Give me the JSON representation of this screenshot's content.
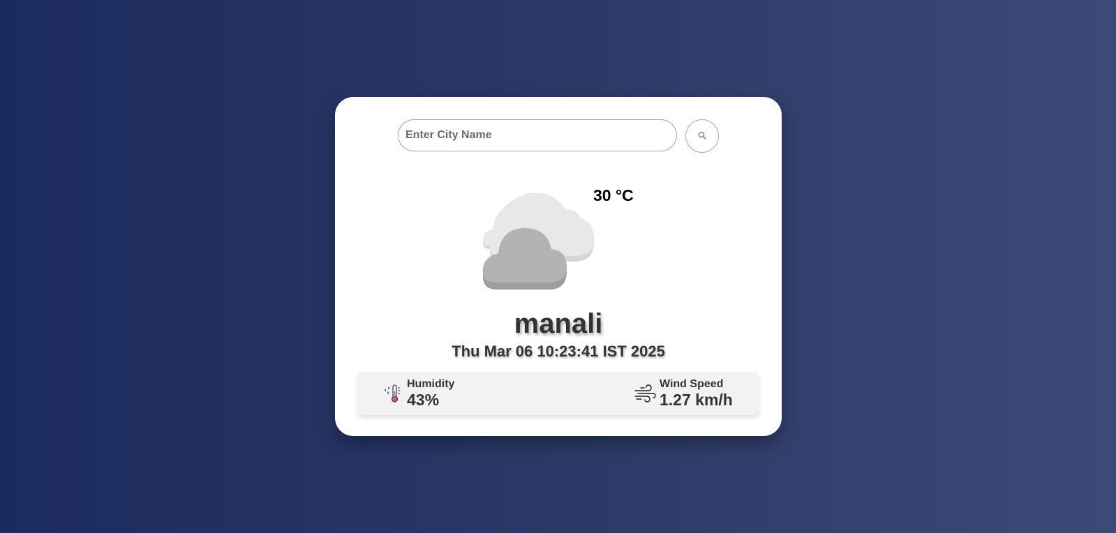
{
  "search": {
    "placeholder": "Enter City Name",
    "value": "",
    "button_icon": "search-icon"
  },
  "weather": {
    "icon": "cloudy-icon",
    "temperature": "30 °C",
    "city": "manali",
    "datetime": "Thu Mar 06 10:23:41 IST 2025"
  },
  "details": {
    "humidity": {
      "icon": "humidity-thermometer-icon",
      "label": "Humidity",
      "value": "43%"
    },
    "wind": {
      "icon": "wind-icon",
      "label": "Wind Speed",
      "value": "1.27 km/h"
    }
  },
  "colors": {
    "background_start": "#1c2b5e",
    "background_end": "#3d4a78",
    "card": "#ffffff",
    "text": "#333333",
    "details_panel": "#f2f2f2"
  }
}
